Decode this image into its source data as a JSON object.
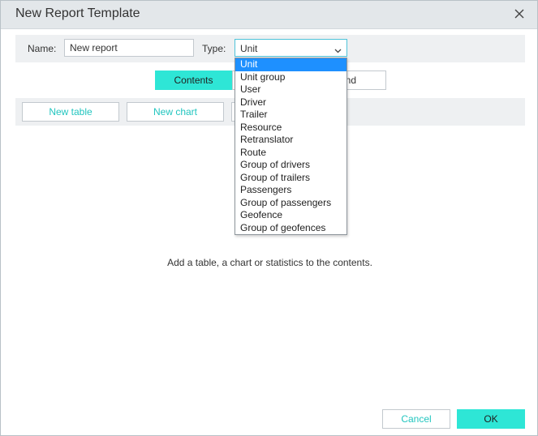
{
  "window": {
    "title": "New Report Template"
  },
  "form": {
    "name_label": "Name:",
    "name_value": "New report",
    "type_label": "Type:",
    "type_value": "Unit"
  },
  "type_options": [
    "Unit",
    "Unit group",
    "User",
    "Driver",
    "Trailer",
    "Resource",
    "Retranslator",
    "Route",
    "Group of drivers",
    "Group of trailers",
    "Passengers",
    "Group of passengers",
    "Geofence",
    "Group of geofences"
  ],
  "tabs": {
    "contents": "Contents",
    "other_partial": "nd"
  },
  "toolbar": {
    "new_table": "New table",
    "new_chart": "New chart"
  },
  "main": {
    "empty_message": "Add a table, a chart or statistics to the contents."
  },
  "footer": {
    "cancel": "Cancel",
    "ok": "OK"
  },
  "colors": {
    "accent": "#2ee6d6",
    "accent_text": "#22c5bf",
    "selection": "#1e90ff",
    "focus_border": "#4fc3d9"
  }
}
